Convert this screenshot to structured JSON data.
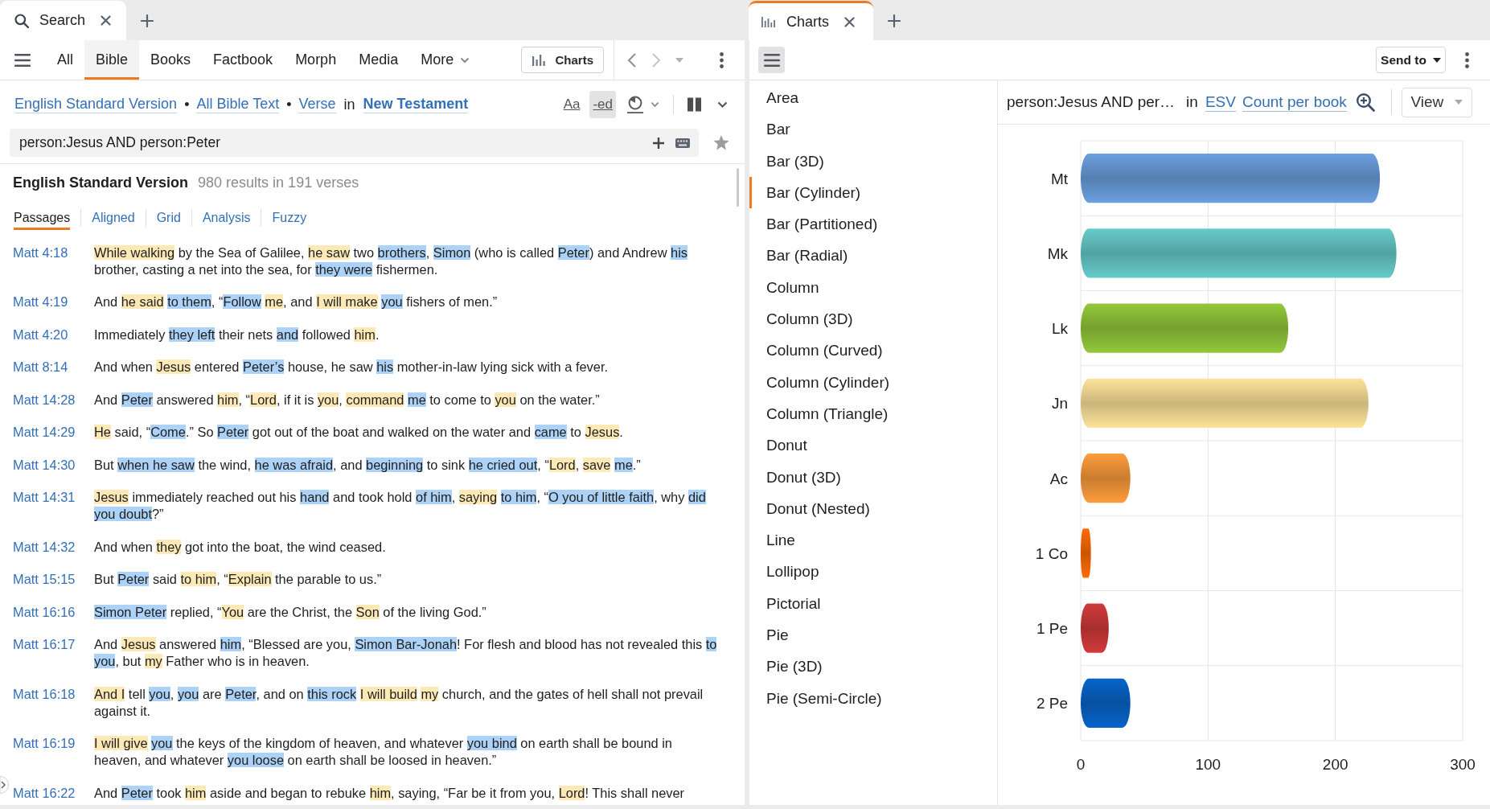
{
  "search_panel": {
    "tabs": [
      {
        "label": "Search",
        "selected": true,
        "focused": false
      }
    ],
    "nav_tabs": [
      {
        "label": "All",
        "selected": false,
        "kind": "tab"
      },
      {
        "label": "Bible",
        "selected": true,
        "kind": "tab"
      },
      {
        "label": "Books",
        "selected": false,
        "kind": "tab"
      },
      {
        "label": "Factbook",
        "selected": false,
        "kind": "tab"
      },
      {
        "label": "Morph",
        "selected": false,
        "kind": "tab"
      },
      {
        "label": "Media",
        "selected": false,
        "kind": "tab"
      },
      {
        "label": "More",
        "selected": false,
        "kind": "menu"
      }
    ],
    "charts_button": "Charts",
    "scope": [
      {
        "kind": "link",
        "text": "English Standard Version"
      },
      {
        "kind": "separator",
        "text": "•"
      },
      {
        "kind": "link",
        "text": "All Bible Text"
      },
      {
        "kind": "separator",
        "text": "•"
      },
      {
        "kind": "link",
        "text": "Verse"
      },
      {
        "kind": "word",
        "text": "in"
      },
      {
        "kind": "strong-link",
        "text": "New Testament"
      }
    ],
    "display_toggles": [
      {
        "label": "Aa",
        "on": false
      },
      {
        "label": "-ed",
        "on": true
      }
    ],
    "query": {
      "value": "person:Jesus AND person:Peter"
    },
    "results": {
      "title": "English Standard Version",
      "summary": "980 results in 191 verses",
      "views": [
        {
          "label": "Passages",
          "selected": true
        },
        {
          "label": "Aligned",
          "selected": false
        },
        {
          "label": "Grid",
          "selected": false
        },
        {
          "label": "Analysis",
          "selected": false
        },
        {
          "label": "Fuzzy",
          "selected": false
        }
      ],
      "verses": [
        {
          "ref": "Matt 4:18",
          "segments": [
            {
              "text": "While walking",
              "color": "#fde9b6"
            },
            {
              "text": " by the Sea of Galilee, "
            },
            {
              "text": "he saw",
              "color": "#fde9b6"
            },
            {
              "text": " two "
            },
            {
              "text": "brothers",
              "color": "#acd2f7"
            },
            {
              "text": ", "
            },
            {
              "text": "Simon",
              "color": "#acd2f7"
            },
            {
              "text": " (who is called "
            },
            {
              "text": "Peter",
              "color": "#acd2f7"
            },
            {
              "text": ") and Andrew "
            },
            {
              "text": "his",
              "color": "#acd2f7"
            },
            {
              "text": " brother, casting a net into the sea, for "
            },
            {
              "text": "they were",
              "color": "#acd2f7"
            },
            {
              "text": " fishermen."
            }
          ]
        },
        {
          "ref": "Matt 4:19",
          "segments": [
            {
              "text": "And "
            },
            {
              "text": "he said ",
              "color": "#fde9b6"
            },
            {
              "text": "to them",
              "color": "#acd2f7"
            },
            {
              "text": ", “"
            },
            {
              "text": "Follow ",
              "color": "#acd2f7"
            },
            {
              "text": "me",
              "color": "#fde9b6"
            },
            {
              "text": ", and "
            },
            {
              "text": "I will make ",
              "color": "#fde9b6"
            },
            {
              "text": "you",
              "color": "#acd2f7"
            },
            {
              "text": " fishers of men.”"
            }
          ]
        },
        {
          "ref": "Matt 4:20",
          "segments": [
            {
              "text": "Immediately "
            },
            {
              "text": "they left",
              "color": "#acd2f7"
            },
            {
              "text": " their nets "
            },
            {
              "text": "and",
              "color": "#acd2f7"
            },
            {
              "text": " followed "
            },
            {
              "text": "him",
              "color": "#fde9b6"
            },
            {
              "text": "."
            }
          ]
        },
        {
          "ref": "Matt 8:14",
          "segments": [
            {
              "text": "And when "
            },
            {
              "text": "Jesus",
              "color": "#fde9b6"
            },
            {
              "text": " entered "
            },
            {
              "text": "Peter’s",
              "color": "#acd2f7"
            },
            {
              "text": " house, he saw "
            },
            {
              "text": "his",
              "color": "#acd2f7"
            },
            {
              "text": " mother-in-law lying sick with a fever."
            }
          ]
        },
        {
          "ref": "Matt 14:28",
          "segments": [
            {
              "text": "And "
            },
            {
              "text": "Peter",
              "color": "#acd2f7"
            },
            {
              "text": " answered "
            },
            {
              "text": "him",
              "color": "#fde9b6"
            },
            {
              "text": ", “"
            },
            {
              "text": "Lord",
              "color": "#fde9b6"
            },
            {
              "text": ", if it is "
            },
            {
              "text": "you",
              "color": "#fde9b6"
            },
            {
              "text": ", "
            },
            {
              "text": "command ",
              "color": "#fde9b6"
            },
            {
              "text": "me",
              "color": "#acd2f7"
            },
            {
              "text": " to come to "
            },
            {
              "text": "you",
              "color": "#fde9b6"
            },
            {
              "text": " on the water.”"
            }
          ]
        },
        {
          "ref": "Matt 14:29",
          "segments": [
            {
              "text": "He",
              "color": "#fde9b6"
            },
            {
              "text": " said, “"
            },
            {
              "text": "Come",
              "color": "#acd2f7"
            },
            {
              "text": ".” So "
            },
            {
              "text": "Peter",
              "color": "#acd2f7"
            },
            {
              "text": " got out of the boat and walked on the water and "
            },
            {
              "text": "came",
              "color": "#acd2f7"
            },
            {
              "text": " to "
            },
            {
              "text": "Jesus",
              "color": "#fde9b6"
            },
            {
              "text": "."
            }
          ]
        },
        {
          "ref": "Matt 14:30",
          "segments": [
            {
              "text": "But "
            },
            {
              "text": "when he saw",
              "color": "#acd2f7"
            },
            {
              "text": " the wind, "
            },
            {
              "text": "he was afraid",
              "color": "#acd2f7"
            },
            {
              "text": ", and "
            },
            {
              "text": "beginning",
              "color": "#acd2f7"
            },
            {
              "text": " to sink "
            },
            {
              "text": "he cried out",
              "color": "#acd2f7"
            },
            {
              "text": ", “"
            },
            {
              "text": "Lord",
              "color": "#fde9b6"
            },
            {
              "text": ", "
            },
            {
              "text": "save ",
              "color": "#fde9b6"
            },
            {
              "text": "me",
              "color": "#acd2f7"
            },
            {
              "text": ".”"
            }
          ]
        },
        {
          "ref": "Matt 14:31",
          "segments": [
            {
              "text": "Jesus",
              "color": "#fde9b6"
            },
            {
              "text": " immediately reached out his "
            },
            {
              "text": "hand",
              "color": "#acd2f7"
            },
            {
              "text": " and took hold "
            },
            {
              "text": "of him",
              "color": "#acd2f7"
            },
            {
              "text": ", "
            },
            {
              "text": "saying ",
              "color": "#fde9b6"
            },
            {
              "text": "to him",
              "color": "#acd2f7"
            },
            {
              "text": ", “"
            },
            {
              "text": "O you of little faith",
              "color": "#acd2f7"
            },
            {
              "text": ", why "
            },
            {
              "text": "did you doubt",
              "color": "#acd2f7"
            },
            {
              "text": "?”"
            }
          ]
        },
        {
          "ref": "Matt 14:32",
          "segments": [
            {
              "text": "And when "
            },
            {
              "text": "they",
              "color": "#fde9b6"
            },
            {
              "text": " got into the boat, the wind ceased."
            }
          ]
        },
        {
          "ref": "Matt 15:15",
          "segments": [
            {
              "text": "But "
            },
            {
              "text": "Peter",
              "color": "#acd2f7"
            },
            {
              "text": " said "
            },
            {
              "text": "to him",
              "color": "#fde9b6"
            },
            {
              "text": ", “"
            },
            {
              "text": "Explain",
              "color": "#fde9b6"
            },
            {
              "text": " the parable to us.”"
            }
          ]
        },
        {
          "ref": "Matt 16:16",
          "segments": [
            {
              "text": "Simon Peter",
              "color": "#acd2f7"
            },
            {
              "text": " replied, “"
            },
            {
              "text": "You",
              "color": "#fde9b6"
            },
            {
              "text": " are the Christ, the "
            },
            {
              "text": "Son",
              "color": "#fde9b6"
            },
            {
              "text": " of the living God.”"
            }
          ]
        },
        {
          "ref": "Matt 16:17",
          "segments": [
            {
              "text": "And "
            },
            {
              "text": "Jesus",
              "color": "#fde9b6"
            },
            {
              "text": " answered "
            },
            {
              "text": "him",
              "color": "#acd2f7"
            },
            {
              "text": ", “Blessed are you, "
            },
            {
              "text": "Simon Bar-Jonah",
              "color": "#acd2f7"
            },
            {
              "text": "! For flesh and blood has not revealed this "
            },
            {
              "text": "to you",
              "color": "#acd2f7"
            },
            {
              "text": ", but "
            },
            {
              "text": "my",
              "color": "#fde9b6"
            },
            {
              "text": " Father who is in heaven."
            }
          ]
        },
        {
          "ref": "Matt 16:18",
          "segments": [
            {
              "text": "And I",
              "color": "#fde9b6"
            },
            {
              "text": " tell "
            },
            {
              "text": "you",
              "color": "#acd2f7"
            },
            {
              "text": ", "
            },
            {
              "text": "you",
              "color": "#acd2f7"
            },
            {
              "text": " are "
            },
            {
              "text": "Peter",
              "color": "#acd2f7"
            },
            {
              "text": ", and on "
            },
            {
              "text": "this rock ",
              "color": "#acd2f7"
            },
            {
              "text": "I will build ",
              "color": "#fde9b6"
            },
            {
              "text": "my",
              "color": "#fde9b6"
            },
            {
              "text": " church, and the gates of hell shall not prevail against it."
            }
          ]
        },
        {
          "ref": "Matt 16:19",
          "segments": [
            {
              "text": "I will give ",
              "color": "#fde9b6"
            },
            {
              "text": "you",
              "color": "#acd2f7"
            },
            {
              "text": " the keys of the kingdom of heaven, and whatever "
            },
            {
              "text": "you bind",
              "color": "#acd2f7"
            },
            {
              "text": " on earth shall be bound in heaven, and whatever "
            },
            {
              "text": "you loose",
              "color": "#acd2f7"
            },
            {
              "text": " on earth shall be loosed in heaven.”"
            }
          ]
        },
        {
          "ref": "Matt 16:22",
          "segments": [
            {
              "text": "And "
            },
            {
              "text": "Peter",
              "color": "#acd2f7"
            },
            {
              "text": " took "
            },
            {
              "text": "him",
              "color": "#fde9b6"
            },
            {
              "text": " aside and began to rebuke "
            },
            {
              "text": "him",
              "color": "#fde9b6"
            },
            {
              "text": ", saying, “Far be it from you, "
            },
            {
              "text": "Lord",
              "color": "#fde9b6"
            },
            {
              "text": "! This shall never"
            }
          ]
        }
      ]
    }
  },
  "charts_panel": {
    "tabs": [
      {
        "label": "Charts",
        "selected": true,
        "focused": true
      }
    ],
    "sidebar_toggle": {
      "on": true
    },
    "send_to": "Send to",
    "chart_types": [
      {
        "label": "Area",
        "selected": false
      },
      {
        "label": "Bar",
        "selected": false
      },
      {
        "label": "Bar (3D)",
        "selected": false
      },
      {
        "label": "Bar (Cylinder)",
        "selected": true
      },
      {
        "label": "Bar (Partitioned)",
        "selected": false
      },
      {
        "label": "Bar (Radial)",
        "selected": false
      },
      {
        "label": "Column",
        "selected": false
      },
      {
        "label": "Column (3D)",
        "selected": false
      },
      {
        "label": "Column (Curved)",
        "selected": false
      },
      {
        "label": "Column (Cylinder)",
        "selected": false
      },
      {
        "label": "Column (Triangle)",
        "selected": false
      },
      {
        "label": "Donut",
        "selected": false
      },
      {
        "label": "Donut (3D)",
        "selected": false
      },
      {
        "label": "Donut (Nested)",
        "selected": false
      },
      {
        "label": "Line",
        "selected": false
      },
      {
        "label": "Lollipop",
        "selected": false
      },
      {
        "label": "Pictorial",
        "selected": false
      },
      {
        "label": "Pie",
        "selected": false
      },
      {
        "label": "Pie (3D)",
        "selected": false
      },
      {
        "label": "Pie (Semi-Circle)",
        "selected": false
      }
    ],
    "header": {
      "query": "person:Jesus AND per…",
      "scope_word": "in",
      "version": "ESV",
      "measure": "Count per book",
      "view_button": "View"
    },
    "chart_data": {
      "type": "bar",
      "orientation": "horizontal",
      "categories": [
        "Mt",
        "Mk",
        "Lk",
        "Jn",
        "Ac",
        "1 Co",
        "1 Pe",
        "2 Pe"
      ],
      "values": [
        235,
        248,
        163,
        226,
        39,
        8,
        22,
        39
      ],
      "xlim": [
        0,
        300
      ],
      "xticks": [
        0,
        100,
        200,
        300
      ]
    }
  }
}
